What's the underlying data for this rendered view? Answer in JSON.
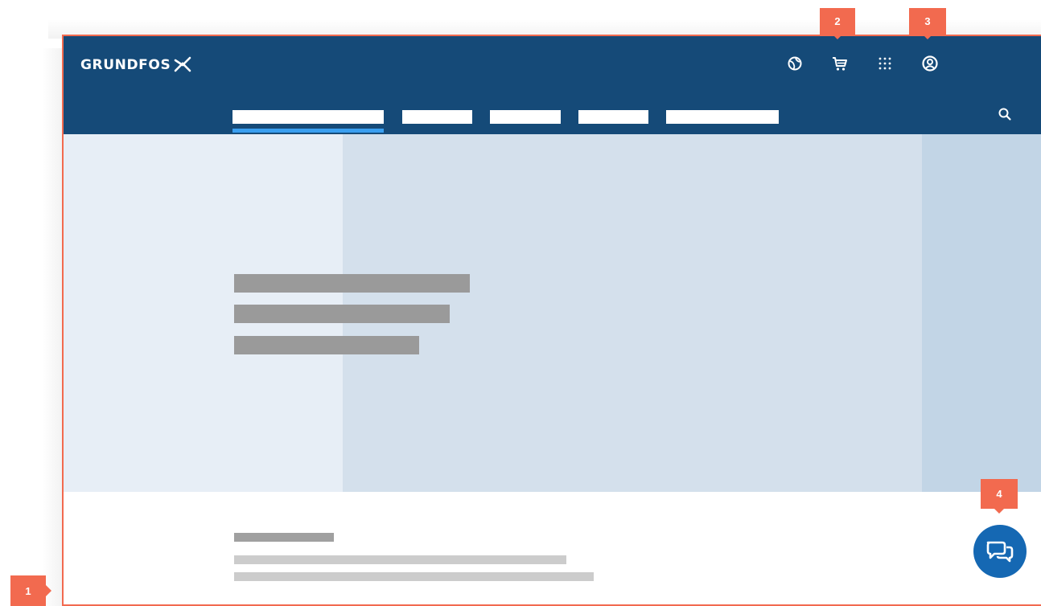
{
  "brand": {
    "logo_text": "GRUNDFOS",
    "logo_icon": "grundfos-x-mark-icon",
    "color": "#154a78"
  },
  "header_icons": [
    "globe-icon",
    "cart-icon",
    "apps-grid-icon",
    "user-account-icon"
  ],
  "nav": {
    "items_count": 5,
    "active_index": 0,
    "active_underline_color": "#3a9ff0",
    "search_icon": "search-icon"
  },
  "chat": {
    "icon": "chat-bubbles-icon",
    "color": "#1568b3"
  },
  "annotations": {
    "color": "#f26a4f",
    "markers": [
      "1",
      "2",
      "3",
      "4"
    ]
  }
}
